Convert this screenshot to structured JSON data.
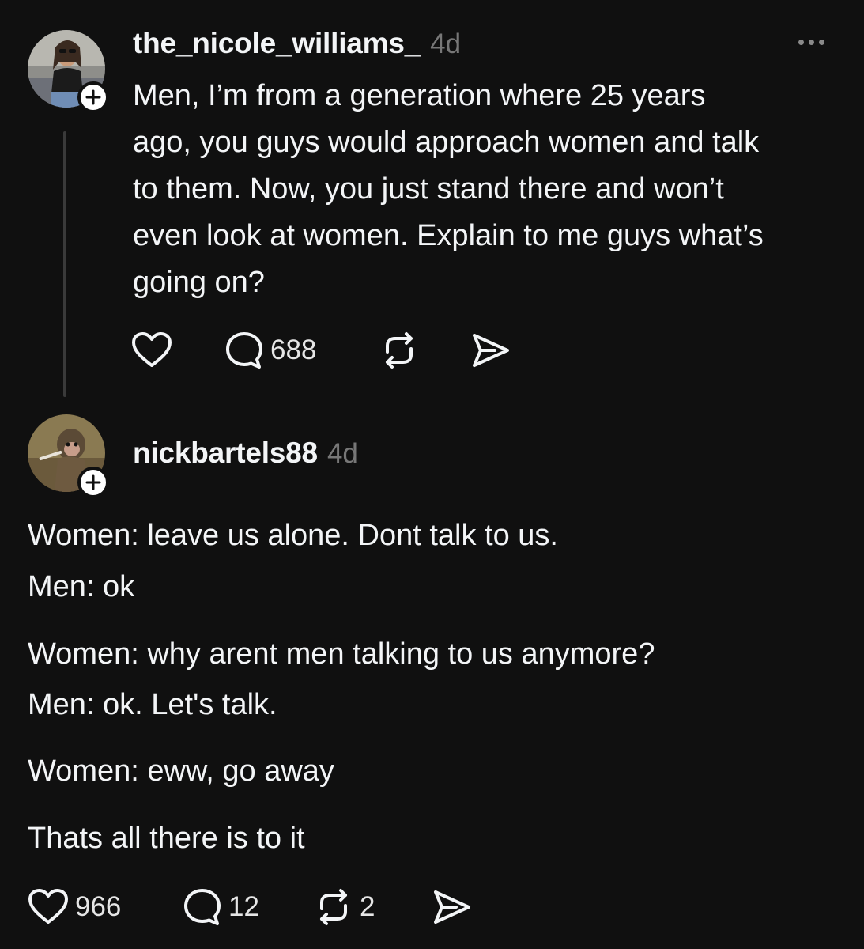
{
  "post": {
    "username": "the_nicole_williams_",
    "time": "4d",
    "text": "Men, I’m from a generation where 25 years\nago, you guys would approach women and talk\nto them. Now, you just stand there and won’t\neven look at women. Explain to me guys what’s\ngoing on?",
    "reply_count": "688",
    "avatar_icon": "profile-photo",
    "more_icon": "ellipsis-icon"
  },
  "reply": {
    "username": "nickbartels88",
    "time": "4d",
    "lines": [
      "Women: leave us alone. Dont talk to us.",
      "Men: ok",
      "Women: why arent men talking to us anymore?",
      "Men: ok. Let's talk.",
      "Women: eww, go away",
      "Thats all there is to it"
    ],
    "like_count": "966",
    "reply_count": "12",
    "repost_count": "2",
    "avatar_icon": "profile-photo"
  },
  "colors": {
    "background": "#101010",
    "text": "#f3f5f7",
    "muted": "#777777",
    "thread_line": "#3a3a3a"
  }
}
